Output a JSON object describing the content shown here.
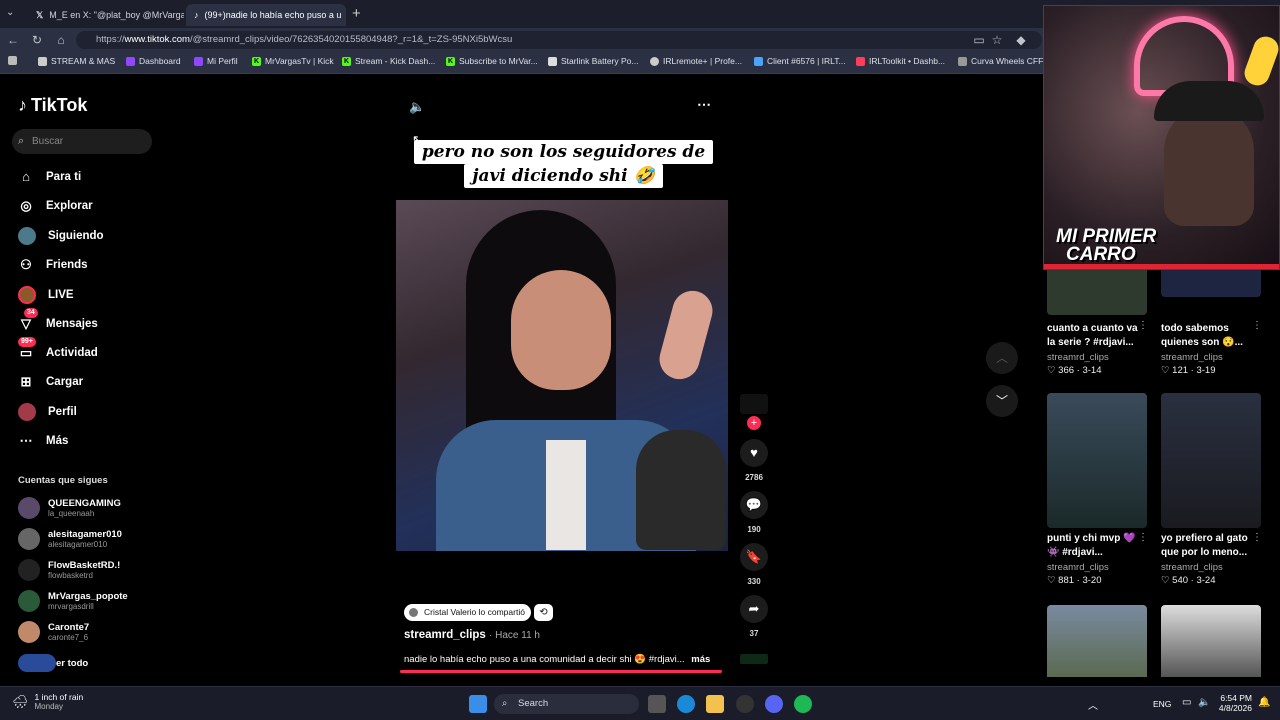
{
  "browser": {
    "tabs": [
      {
        "label": "M_E en X: \"@plat_boy @MrVargas",
        "active": false
      },
      {
        "label": "(99+)nadie lo había echo puso a u",
        "active": true
      }
    ],
    "url_prefix": "https://",
    "url_domain": "www.tiktok.com",
    "url_path": "/@streamrd_clips/video/7626354020155804948?_r=1&_t=ZS-95NXi5bWcsu",
    "bookmarks": [
      "STREAM & MAS",
      "Dashboard",
      "Mi Perfil",
      "MrVargasTv | Kick",
      "Stream - Kick Dash...",
      "Subscribe to MrVar...",
      "Starlink Battery Po...",
      "IRLremote+ | Profe...",
      "Client #6576 | IRLT...",
      "IRLToolkit • Dashb...",
      "Curva Wheels CFF7"
    ]
  },
  "sidebar": {
    "logo": "TikTok",
    "search_placeholder": "Buscar",
    "nav": [
      {
        "label": "Para ti",
        "icon": "home-icon"
      },
      {
        "label": "Explorar",
        "icon": "compass-icon"
      },
      {
        "label": "Siguiendo",
        "icon": "following-avatar-icon"
      },
      {
        "label": "Friends",
        "icon": "friends-icon"
      },
      {
        "label": "LIVE",
        "icon": "live-avatar-icon"
      },
      {
        "label": "Mensajes",
        "icon": "messages-icon",
        "badge": "34"
      },
      {
        "label": "Actividad",
        "icon": "activity-icon",
        "badge": "99+"
      },
      {
        "label": "Cargar",
        "icon": "upload-icon"
      },
      {
        "label": "Perfil",
        "icon": "profile-avatar-icon"
      },
      {
        "label": "Más",
        "icon": "more-icon"
      }
    ],
    "follows_title": "Cuentas que sigues",
    "accounts": [
      {
        "name": "QUEENGAMING",
        "handle": "la_queenaah"
      },
      {
        "name": "alesitagamer010",
        "handle": "alesitagamer010"
      },
      {
        "name": "FlowBasketRD.!",
        "handle": "flowbasketrd"
      },
      {
        "name": "MrVargas_popote",
        "handle": "mrvargasdrill"
      },
      {
        "name": "Caronte7",
        "handle": "caronte7_6"
      }
    ],
    "see_all": "er todo"
  },
  "video": {
    "caption_line1": "pero no son los seguidores de",
    "caption_line2": "javi diciendo shi 🤣",
    "shared_by": "Cristal Valerio lo compartió",
    "author": "streamrd_clips",
    "time": "· Hace 11 h",
    "description": "nadie lo había echo puso a una comunidad a decir shi 😍 #rdjavi...",
    "more": "más",
    "likes": "2786",
    "comments": "190",
    "saves": "330",
    "shares": "37"
  },
  "webcam": {
    "overlay_text_1": "MI PRIMER",
    "overlay_text_2": "CARRO"
  },
  "related": [
    {
      "title": "cuanto a cuanto va la serie ? #rdjavi...",
      "author": "streamrd_clips",
      "likes": "366",
      "date": "3-14"
    },
    {
      "title": "todo sabemos quienes son 😯...",
      "author": "streamrd_clips",
      "likes": "121",
      "date": "3-19"
    },
    {
      "title": "punti y chi mvp 💜 👾 #rdjavi...",
      "author": "streamrd_clips",
      "likes": "881",
      "date": "3-20"
    },
    {
      "title": "yo prefiero al gato que por lo meno...",
      "author": "streamrd_clips",
      "likes": "540",
      "date": "3-24"
    }
  ],
  "taskbar": {
    "weather": "1 inch of rain",
    "weather_sub": "Monday",
    "search": "Search",
    "lang": "ENG",
    "time": "6:54 PM",
    "date": "4/8/2026"
  },
  "colors": {
    "accent": "#fe2c55",
    "bg": "#000000"
  }
}
